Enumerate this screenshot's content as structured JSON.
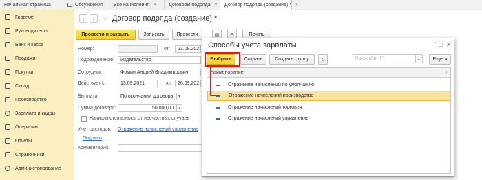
{
  "tabs": [
    {
      "label": "Начальная страница",
      "closable": false
    },
    {
      "label": "Обсуждения",
      "closable": false
    },
    {
      "label": "Все начисления",
      "closable": true
    },
    {
      "label": "Договоры подряда",
      "closable": true
    },
    {
      "label": "Договор подряда (создание) *",
      "closable": true
    }
  ],
  "sidebar": {
    "items": [
      {
        "label": "Главное",
        "icon": "menu-icon"
      },
      {
        "label": "Руководителю",
        "icon": "chart-icon"
      },
      {
        "label": "Банк и касса",
        "icon": "bank-icon"
      },
      {
        "label": "Продажи",
        "icon": "cart-icon"
      },
      {
        "label": "Покупки",
        "icon": "basket-icon"
      },
      {
        "label": "Склад",
        "icon": "warehouse-icon"
      },
      {
        "label": "Производство",
        "icon": "factory-icon"
      },
      {
        "label": "Зарплата и кадры",
        "icon": "people-icon"
      },
      {
        "label": "Операции",
        "icon": "operations-icon"
      },
      {
        "label": "Отчеты",
        "icon": "report-icon"
      },
      {
        "label": "Справочники",
        "icon": "book-icon"
      },
      {
        "label": "Администрирование",
        "icon": "gear-icon"
      }
    ]
  },
  "form": {
    "title": "Договор подряда (создание) *",
    "toolbar": {
      "post_close": "Провести и закрыть",
      "save": "Записать",
      "post": "Провести",
      "print": "Печать"
    },
    "fields": {
      "number_label": "Номер:",
      "number_value": "",
      "from_label": "от:",
      "date_value": "23.09.2021",
      "dept_label": "Подразделение:",
      "dept_value": "Издательство",
      "employee_label": "Сотрудник:",
      "employee_value": "Фомин Андрей Владимирович",
      "valid_label": "Действует с:",
      "valid_from": "13.09.2021",
      "to_label": "по:",
      "valid_to": "26.09.2021",
      "payment_label": "Выплата:",
      "payment_value": "По окончании договора",
      "amount_label": "Сумма договора:",
      "amount_value": "50 000,00",
      "accident_label": "Начисляются взносы от несчастных случаев",
      "expense_label": "Учет расходов:",
      "expense_value": "Отражение начислений управление",
      "signatures_link": "Подписи",
      "comment_label": "Комментарий:"
    }
  },
  "dialog": {
    "title": "Способы учета зарплаты",
    "buttons": {
      "select": "Выбрать",
      "create": "Создать",
      "create_group": "Создать группу",
      "more": "Еще"
    },
    "search_placeholder": "Поиск (Ctrl+F)",
    "column": "Наименование",
    "rows": [
      {
        "label": "Отражение начислений по умолчанию",
        "selected": false
      },
      {
        "label": "Отражение начислений производство",
        "selected": true
      },
      {
        "label": "Отражение начислений торговля",
        "selected": false
      },
      {
        "label": "Отражение начислений управление",
        "selected": false
      }
    ]
  },
  "colors": {
    "sidebar_bg": "#fbeec0",
    "primary_button": "#f6cf2c",
    "selected_row": "#f9e29b",
    "highlight": "#d32020",
    "link": "#2d6ab5"
  }
}
